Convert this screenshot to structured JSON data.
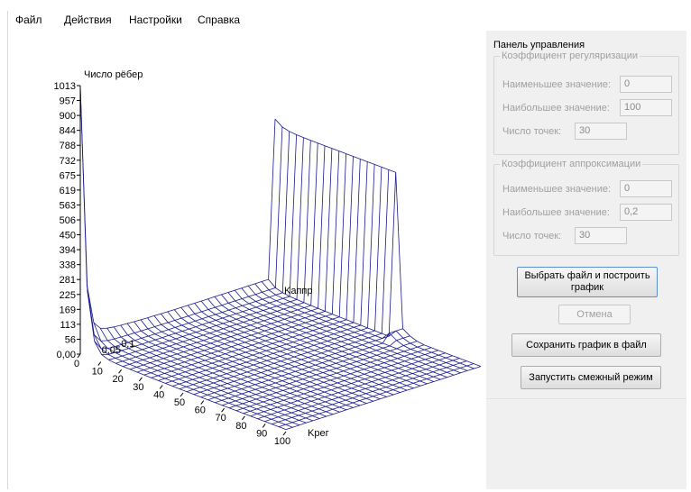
{
  "menu": [
    "Файл",
    "Действия",
    "Настройки",
    "Справка"
  ],
  "chart_data": {
    "type": "surface",
    "z_label": "Число рёбер",
    "x_label": "Kрег",
    "y_label": "Kаппр",
    "z_ticks": [
      "1013",
      "957",
      "900",
      "844",
      "788",
      "732",
      "675",
      "619",
      "563",
      "506",
      "450",
      "394",
      "338",
      "281",
      "225",
      "169",
      "113",
      "56",
      "0,00"
    ],
    "x_ticks": [
      "0",
      "10",
      "20",
      "30",
      "40",
      "50",
      "60",
      "70",
      "80",
      "90",
      "100"
    ],
    "y_ticks": [
      "0,05",
      "0,1"
    ],
    "zlim": [
      0,
      1013
    ],
    "xlim": [
      0,
      100
    ],
    "ylim": [
      0,
      0.2
    ],
    "grid_points": 30,
    "line_color": "#1a1a8c",
    "back_wall_value": 619,
    "front_peak_value": 1013
  },
  "panel": {
    "title": "Панель управления",
    "reg": {
      "legend": "Коэффициент регуляризации",
      "min_label": "Наименьшее значение:",
      "min_value": "0",
      "max_label": "Наибольшее значение:",
      "max_value": "100",
      "points_label": "Число точек:",
      "points_value": "30"
    },
    "approx": {
      "legend": "Коэффициент аппроксимации",
      "min_label": "Наименьшее значение:",
      "min_value": "0",
      "max_label": "Наибольшее значение:",
      "max_value": "0,2",
      "points_label": "Число точек:",
      "points_value": "30"
    },
    "buttons": {
      "choose_file": "Выбрать файл и построить график",
      "cancel": "Отмена",
      "save": "Сохранить график в файл",
      "adjacent": "Запустить смежный режим"
    }
  }
}
